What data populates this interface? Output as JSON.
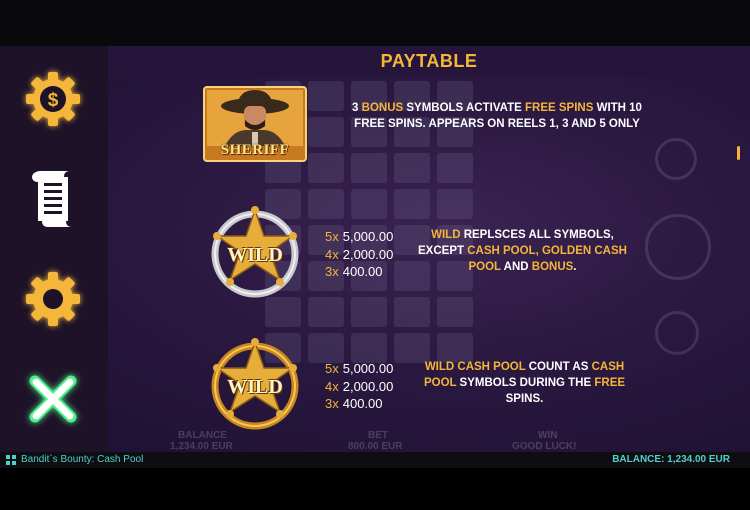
{
  "title": "PAYTABLE",
  "sidebar": {
    "items": [
      {
        "name": "bet-coin",
        "icon": "dollar-gear-icon"
      },
      {
        "name": "paytable",
        "icon": "scroll-icon"
      },
      {
        "name": "settings",
        "icon": "gear-icon"
      },
      {
        "name": "close",
        "icon": "close-icon"
      }
    ]
  },
  "rows": [
    {
      "symbol_label": "SHERIFF",
      "desc_parts": [
        {
          "t": "3 ",
          "hl": false
        },
        {
          "t": "BONUS",
          "hl": true
        },
        {
          "t": " SYMBOLS ACTIVATE ",
          "hl": false
        },
        {
          "t": "FREE SPINS",
          "hl": true
        },
        {
          "t": " WITH 10 FREE SPINS. APPEARS ON REELS 1, 3 AND 5 ONLY",
          "hl": false
        }
      ]
    },
    {
      "symbol_label": "WILD",
      "payouts": [
        {
          "mult": "5x",
          "value": "5,000.00"
        },
        {
          "mult": "4x",
          "value": "2,000.00"
        },
        {
          "mult": "3x",
          "value": "400.00"
        }
      ],
      "desc_parts": [
        {
          "t": "WILD",
          "hl": true
        },
        {
          "t": " REPLSCES ALL SYMBOLS, EXCEPT ",
          "hl": false
        },
        {
          "t": "CASH POOL, GOLDEN CASH POOL",
          "hl": true
        },
        {
          "t": " AND ",
          "hl": false
        },
        {
          "t": "BONUS",
          "hl": true
        },
        {
          "t": ".",
          "hl": false
        }
      ]
    },
    {
      "symbol_label": "WILD",
      "payouts": [
        {
          "mult": "5x",
          "value": "5,000.00"
        },
        {
          "mult": "4x",
          "value": "2,000.00"
        },
        {
          "mult": "3x",
          "value": "400.00"
        }
      ],
      "desc_parts": [
        {
          "t": "WILD CASH POOL",
          "hl": true
        },
        {
          "t": " COUNT AS ",
          "hl": false
        },
        {
          "t": "CASH POOL",
          "hl": true
        },
        {
          "t": " SYMBOLS DURING THE ",
          "hl": false
        },
        {
          "t": "FREE",
          "hl": true
        },
        {
          "t": " SPINS.",
          "hl": false
        }
      ]
    }
  ],
  "background_footer": {
    "balance_label": "BALANCE",
    "balance_value": "1,234.00 EUR",
    "bet_label": "BET",
    "bet_value": "800.00 EUR",
    "win_label": "WIN",
    "win_value": "GOOD LUCK!"
  },
  "status_bar": {
    "game_name": "Bandit`s Bounty: Cash Pool",
    "balance": "BALANCE: 1,234.00 EUR"
  },
  "colors": {
    "accent": "#f4b63a",
    "status_text": "#4fd0c8",
    "close_green": "#4ef08a"
  }
}
